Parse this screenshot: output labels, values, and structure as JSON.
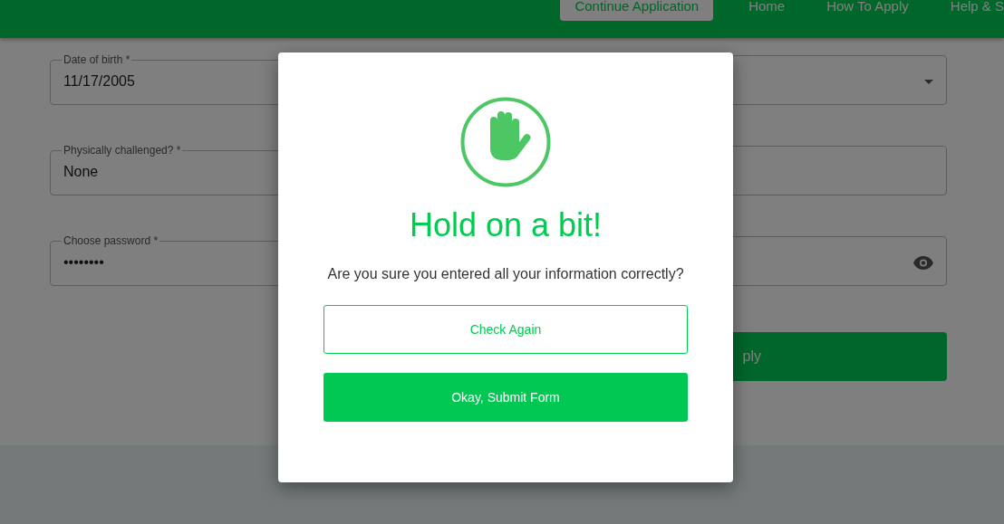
{
  "header": {
    "nav": [
      {
        "label": "Continue Application",
        "kind": "button"
      },
      {
        "label": "Home",
        "kind": "link"
      },
      {
        "label": "How To Apply",
        "kind": "link"
      },
      {
        "label": "Help & S",
        "kind": "link"
      }
    ]
  },
  "form": {
    "fields": [
      {
        "label": "Date of birth *",
        "value": "11/17/2005",
        "kind": "text"
      },
      {
        "kind": "select"
      },
      {
        "label": "Physically challenged? *",
        "value": "None",
        "kind": "text"
      },
      {
        "kind": "text"
      },
      {
        "label": "Choose password *",
        "value": "••••••••",
        "kind": "text"
      },
      {
        "kind": "password"
      }
    ],
    "submit": {
      "label": "ply"
    }
  },
  "dialog": {
    "title": "Hold on a bit!",
    "message": "Are you sure you entered all your information correctly?",
    "buttons": [
      {
        "label": "Check Again",
        "kind": "outline"
      },
      {
        "label": "Okay, Submit Form",
        "kind": "primary"
      }
    ]
  }
}
